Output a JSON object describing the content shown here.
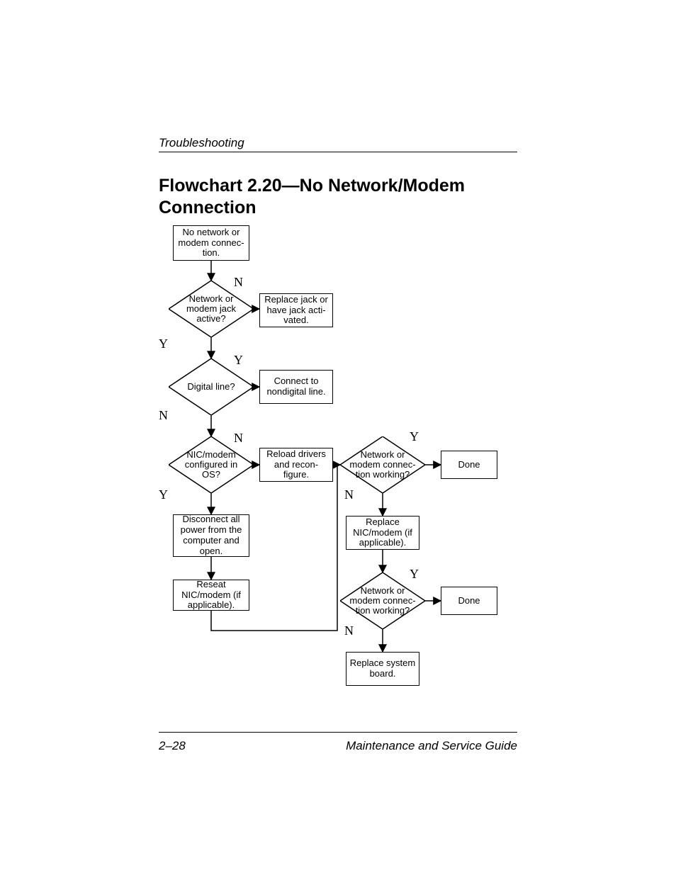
{
  "header": {
    "running_head": "Troubleshooting",
    "title": "Flowchart 2.20—No Network/Modem Connection"
  },
  "footer": {
    "page": "2–28",
    "guide": "Maintenance and Service Guide"
  },
  "flow": {
    "start": "No network or modem connec-tion.",
    "d1": "Network or modem jack active?",
    "p_replace_jack": "Replace jack or have jack acti-vated.",
    "d2": "Digital line?",
    "p_connect_nondigital": "Connect to nondigital line.",
    "d3": "NIC/modem configured in OS?",
    "p_reload": "Reload drivers and recon-figure.",
    "p_disconnect": "Disconnect all power from the computer and open.",
    "p_reseat": "Reseat NIC/modem (if applicable).",
    "d4": "Network or modem connec-tion working?",
    "p_done1": "Done",
    "p_replace_nic": "Replace NIC/modem (if applicable).",
    "d5": "Network or modem connec-tion working?",
    "p_done2": "Done",
    "p_replace_sysboard": "Replace system board.",
    "labels": {
      "Y": "Y",
      "N": "N"
    }
  }
}
